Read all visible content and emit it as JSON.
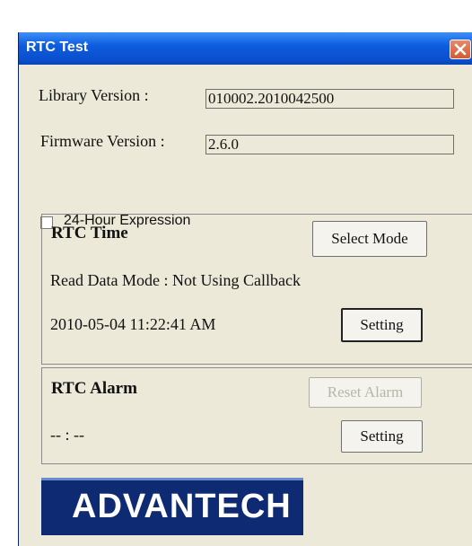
{
  "window": {
    "title": "RTC Test"
  },
  "library": {
    "label": "Library Version :",
    "value": "010002.2010042500"
  },
  "firmware": {
    "label": "Firmware Version :",
    "value": "2.6.0"
  },
  "hour24": {
    "label": "24-Hour Expression",
    "checked": false
  },
  "rtc_time": {
    "title": "RTC Time",
    "select_mode_label": "Select Mode",
    "read_mode_text": "Read Data Mode : Not Using Callback",
    "datetime": "2010-05-04 11:22:41 AM",
    "setting_label": "Setting"
  },
  "rtc_alarm": {
    "title": "RTC Alarm",
    "reset_alarm_label": "Reset Alarm",
    "alarm_time": "-- : --",
    "setting_label": "Setting"
  },
  "logo": {
    "text": "ADVANTECH"
  }
}
